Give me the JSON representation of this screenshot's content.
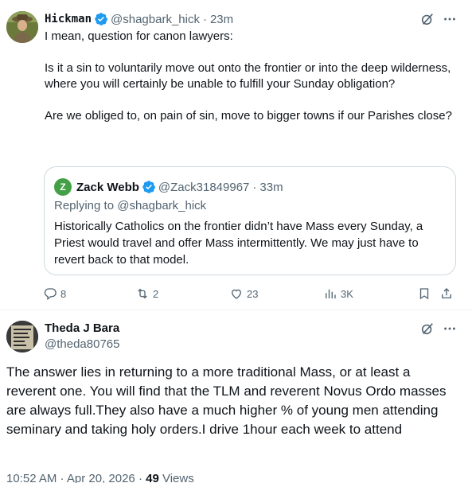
{
  "tweet": {
    "author_name": "Hickman",
    "author_handle": "@shagbark_hick",
    "separator": "·",
    "time": "23m",
    "paragraphs": [
      "I mean, question for canon lawyers:",
      "Is it a sin to voluntarily move out onto the frontier or into the deep wilderness, where you will certainly be unable to fulfill your Sunday obligation?",
      "Are we obliged to, on pain of sin, move to bigger towns if our Parishes close?"
    ],
    "quote": {
      "avatar_letter": "Z",
      "author_name": "Zack Webb",
      "author_handle": "@Zack31849967",
      "separator": "·",
      "time": "33m",
      "replying_prefix": "Replying to",
      "replying_handle": "@shagbark_hick",
      "text": "Historically Catholics on the frontier didn’t have Mass every Sunday, a Priest would travel and offer Mass intermittently. We may just have to revert back to that model."
    },
    "actions": {
      "replies": "8",
      "reposts": "2",
      "likes": "23",
      "views": "3K"
    }
  },
  "reply": {
    "author_name": "Theda J Bara",
    "author_handle": "@theda80765",
    "text": "The answer lies in returning to a more traditional Mass, or at least a reverent one.  You will find that the TLM and reverent Novus Ordo masses are always full.They also have a much higher % of young men attending seminary and taking holy orders.I drive 1hour each week to attend",
    "timestamp": "10:52 AM · Apr 20, 2026 · ",
    "views_count": "49",
    "views_label": " Views"
  },
  "colors": {
    "verified_blue": "#1d9bf0",
    "secondary_text": "#536471",
    "border": "#cfd9de"
  }
}
